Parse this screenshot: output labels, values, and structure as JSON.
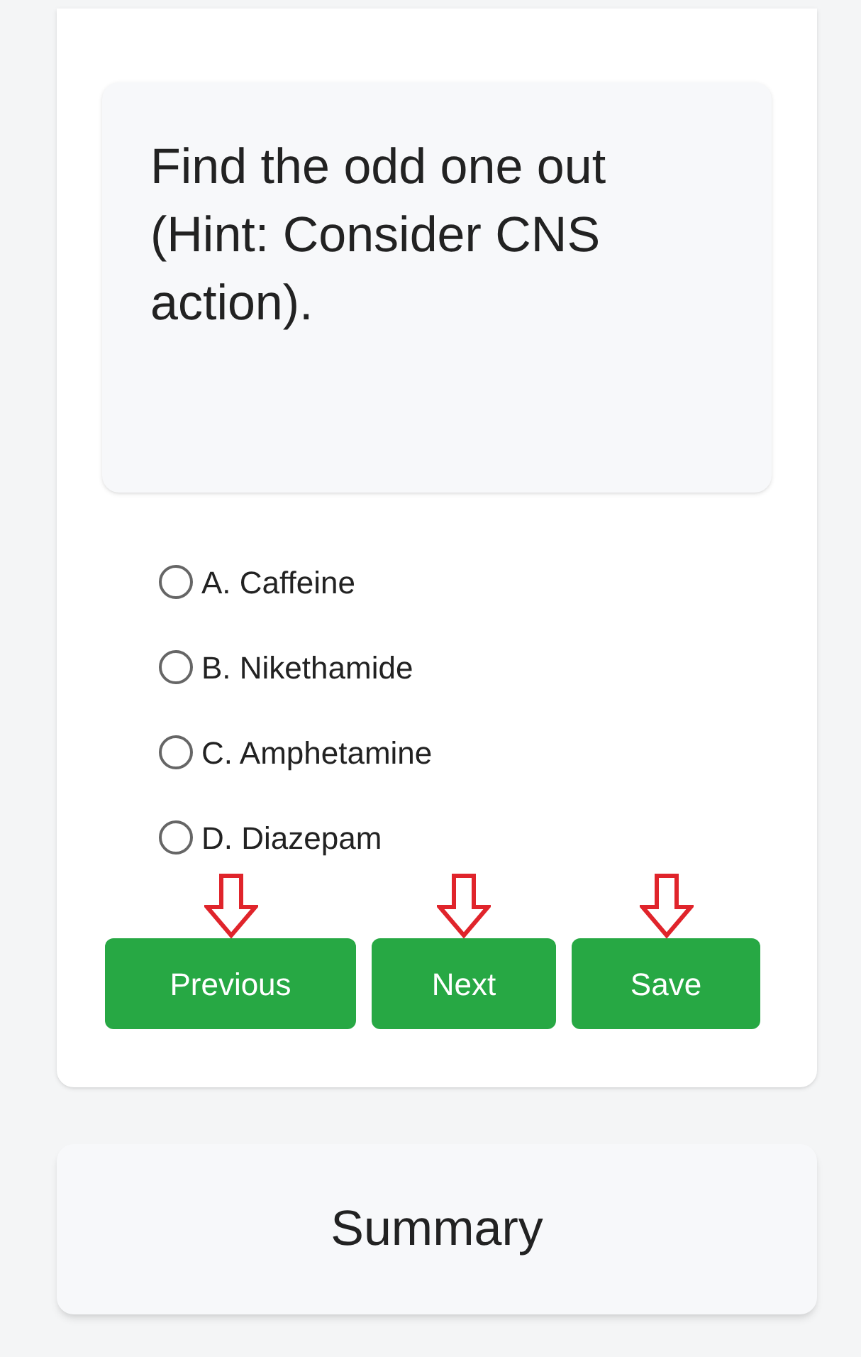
{
  "question": {
    "text": "Find the odd one out (Hint: Consider CNS action)."
  },
  "options": [
    {
      "label": "A. Caffeine",
      "selected": false
    },
    {
      "label": "B. Nikethamide",
      "selected": false
    },
    {
      "label": "C. Amphetamine",
      "selected": false
    },
    {
      "label": "D. Diazepam",
      "selected": false
    }
  ],
  "buttons": [
    {
      "label": "Previous"
    },
    {
      "label": "Next"
    },
    {
      "label": "Save"
    }
  ],
  "summary": {
    "title": "Summary"
  }
}
